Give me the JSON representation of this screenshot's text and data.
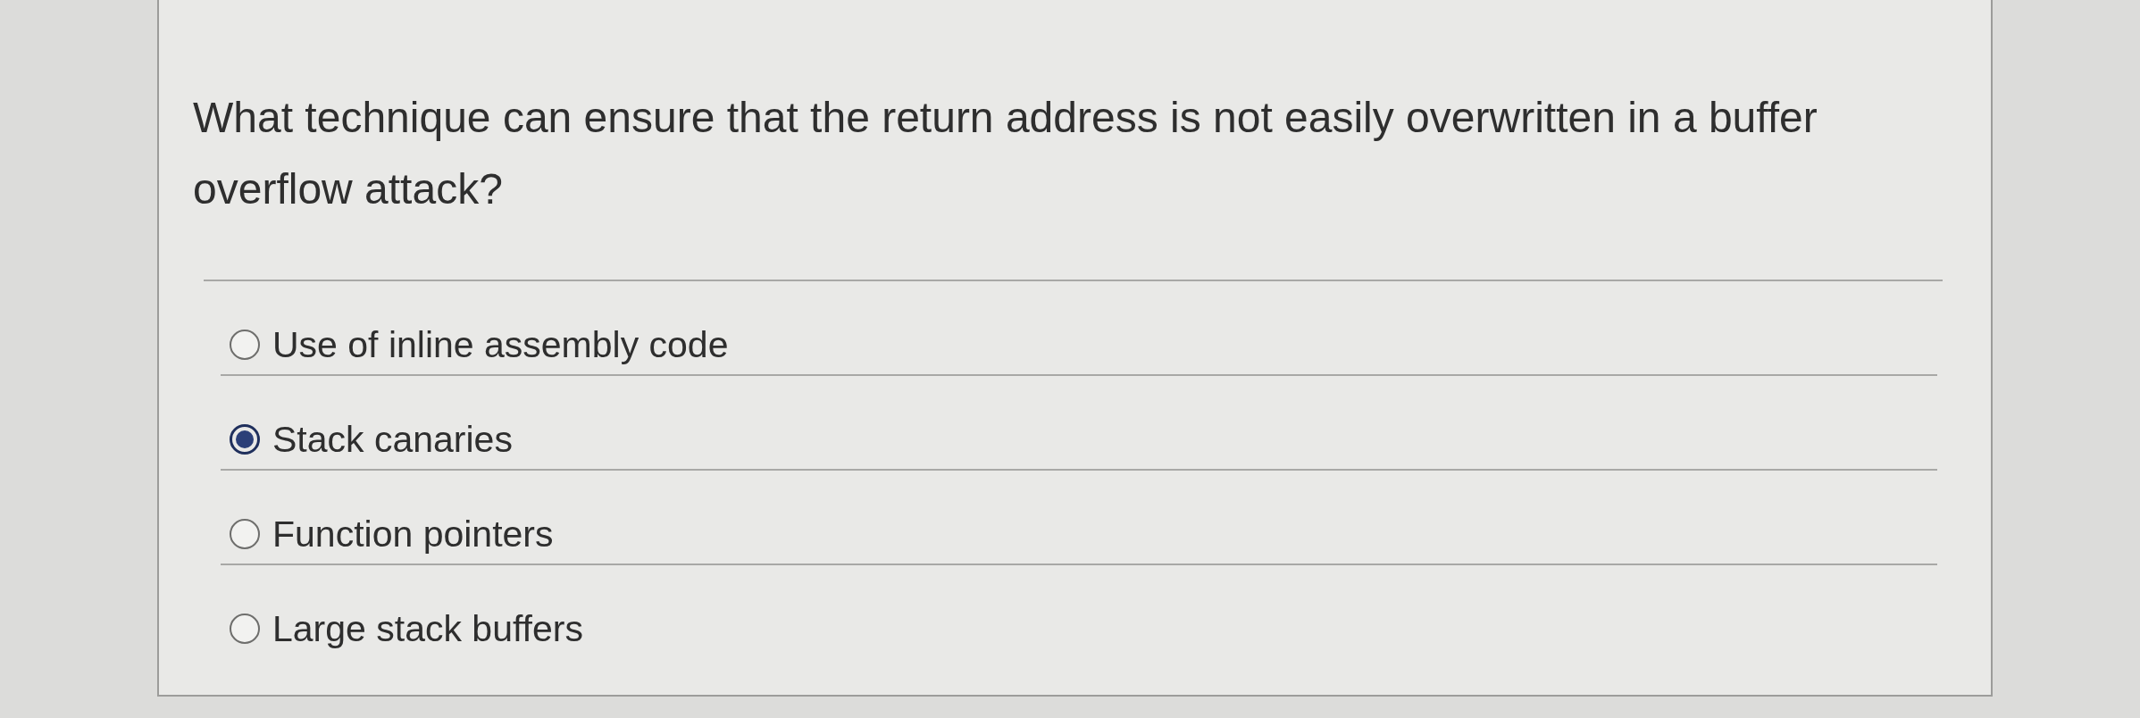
{
  "question": {
    "text": "What technique can ensure that the return address is not easily overwritten in a buffer overflow attack?"
  },
  "options": [
    {
      "label": "Use of inline assembly code",
      "selected": false
    },
    {
      "label": "Stack canaries",
      "selected": true
    },
    {
      "label": "Function pointers",
      "selected": false
    },
    {
      "label": "Large stack buffers",
      "selected": false
    }
  ]
}
